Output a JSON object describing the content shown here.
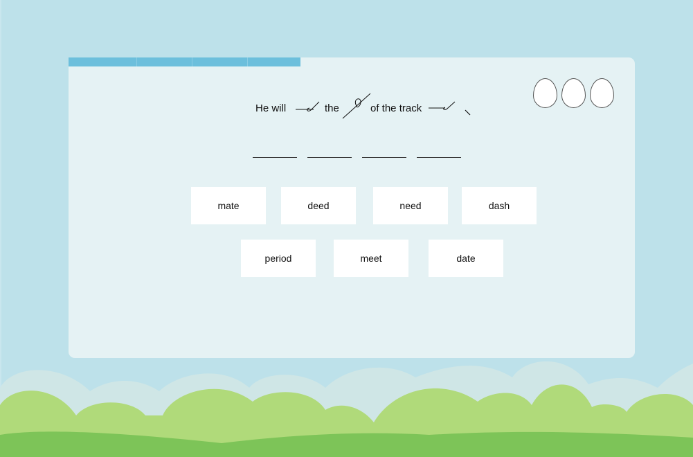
{
  "progress": {
    "fraction": 0.41,
    "segments": 4
  },
  "lives": {
    "eggs": 3
  },
  "sentence": {
    "word_1": "He will",
    "word_2": "the",
    "word_3": "of the track",
    "shorthand_1": "outline-1-icon",
    "shorthand_2": "outline-2-icon",
    "shorthand_3": "outline-3-icon",
    "shorthand_4": "comma-icon"
  },
  "answer_slots": {
    "count": 4
  },
  "word_bank": [
    "mate",
    "deed",
    "need",
    "dash",
    "period",
    "meet",
    "date"
  ],
  "colors": {
    "sky": "#bde1ea",
    "card": "#e5f2f4",
    "progress": "#6cbfdc",
    "hills_back": "#cfe6e6",
    "hills_mid": "#b0da7a",
    "hills_front": "#7dc458"
  }
}
